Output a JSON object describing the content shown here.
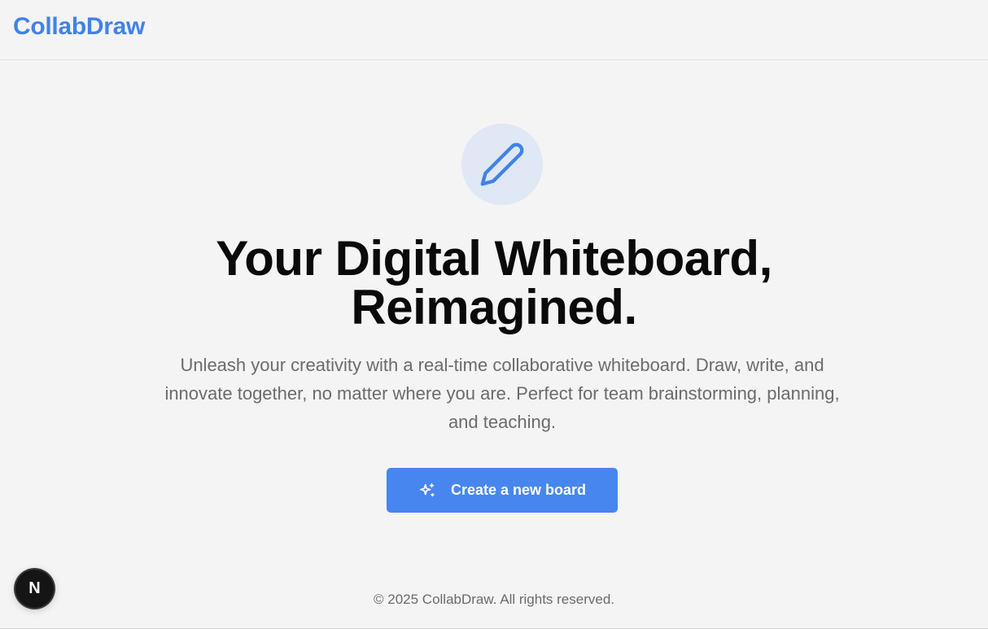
{
  "header": {
    "logo_text": "CollabDraw"
  },
  "hero": {
    "icon": "pencil-icon",
    "title_line1": "Your Digital Whiteboard,",
    "title_line2": "Reimagined.",
    "subtitle": "Unleash your creativity with a real-time collaborative whiteboard. Draw, write, and innovate together, no matter where you are. Perfect for team brainstorming, planning, and teaching.",
    "cta_label": "Create a new board",
    "cta_icon": "sparkles-icon"
  },
  "footer": {
    "copyright": "© 2025 CollabDraw. All rights reserved."
  },
  "dev_badge": {
    "letter": "N",
    "icon": "nextjs-icon"
  },
  "colors": {
    "accent": "#4282e8",
    "button": "#4786ee",
    "icon_circle_bg": "#e0e7f5",
    "page_bg": "#f4f4f4",
    "heading": "#0a0a0a",
    "muted_text": "#6b6b6b"
  }
}
